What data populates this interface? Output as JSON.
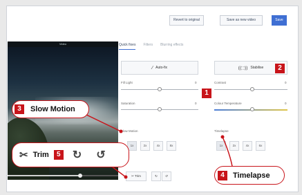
{
  "toolbar": {
    "revert_label": "Revert to original",
    "save_copy_label": "Save as new video",
    "save_label": "Save"
  },
  "video": {
    "title": "Video",
    "seek_progress": 0.65
  },
  "tabs": [
    {
      "label": "Quick fixes",
      "active": true
    },
    {
      "label": "Filters",
      "active": false
    },
    {
      "label": "Blurring effects",
      "active": false
    }
  ],
  "autofix": {
    "label": "Auto-fix",
    "icon": "wand-icon"
  },
  "stabilise": {
    "label": "Stabilise",
    "icon": "stabilise-icon"
  },
  "sliders": {
    "fill_light": {
      "label": "Fill Light",
      "value": "0"
    },
    "contrast": {
      "label": "Contrast",
      "value": "0"
    },
    "saturation": {
      "label": "Saturation",
      "value": "0"
    },
    "colour_temperature": {
      "label": "Colour Temperature",
      "value": "0"
    }
  },
  "slow_motion": {
    "label": "Slow Motion",
    "options": [
      "1x",
      "2x",
      "4x",
      "8x"
    ]
  },
  "timelapse": {
    "label": "Timelapse",
    "options": [
      "1x",
      "2x",
      "4x",
      "6x"
    ]
  },
  "trim_small": {
    "label": "Trim"
  },
  "callouts": {
    "c1": {
      "badge": "1"
    },
    "c2": {
      "badge": "2"
    },
    "c3": {
      "badge": "3",
      "text": "Slow Motion"
    },
    "c4": {
      "badge": "4",
      "text": "Timelapse"
    },
    "c5": {
      "badge": "5",
      "text": "Trim"
    }
  },
  "colors": {
    "accent": "#3f6fd3",
    "callout_red": "#c8141a"
  }
}
